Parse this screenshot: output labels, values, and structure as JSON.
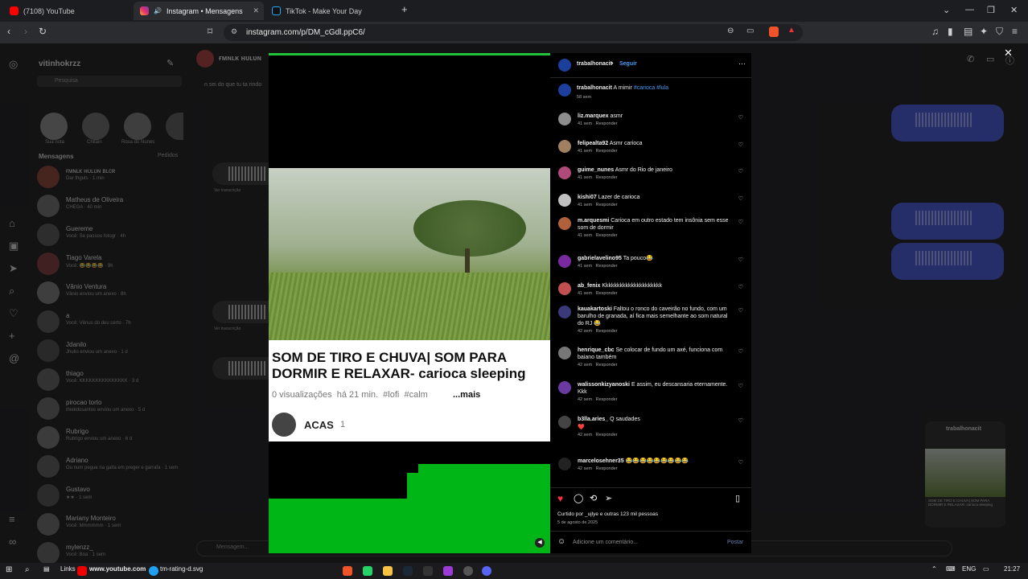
{
  "browser": {
    "tabs": [
      {
        "label": "(7108) YouTube"
      },
      {
        "label": "Instagram • Mensagens"
      },
      {
        "label": "TikTok - Make Your Day"
      }
    ],
    "url": "instagram.com/p/DM_cGdl.ppC6/"
  },
  "sidebar": {
    "username": "vitinhokrzz",
    "search_placeholder": "Pesquisa",
    "notes": [
      {
        "label": "Sua nota"
      },
      {
        "label": "Chitãin"
      },
      {
        "label": "Rosa do Nunes"
      }
    ],
    "section_title": "Mensagens",
    "section_link": "Pedidos",
    "threads": [
      {
        "name": "ғᴍɴʟᴋ ʜᴜʟᴜɴ ʙʟᴄʀ",
        "sub": "Dar thguts · 1 min"
      },
      {
        "name": "Matheus de Oliveira",
        "sub": "CHEGA · 40 min"
      },
      {
        "name": "Guereme",
        "sub": "Você: Se passou fotogr · 4h"
      },
      {
        "name": "Tiago Varela",
        "sub": "Você: 😂😂😂😂 · 9h"
      },
      {
        "name": "Vânio Ventura",
        "sub": "Vânio enviou um anexo · 8h"
      },
      {
        "name": "a",
        "sub": "Você: Vênus do deu certo · 7h"
      },
      {
        "name": "Jdanilo",
        "sub": "Jhulio enviou um anexo · 1 d"
      },
      {
        "name": "thiago",
        "sub": "Você: KKKKKKKKKKKKKKK · 3 d"
      },
      {
        "name": "pirocao torto",
        "sub": "thiekdosantos enviou um anexo · 5 d"
      },
      {
        "name": "Rubrigo",
        "sub": "Rubrigo enviou um anexo · 6 d"
      },
      {
        "name": "Adriano",
        "sub": "Ou num pegue na gaita em preger e garrafa · 1 sem"
      },
      {
        "name": "Gustavo",
        "sub": "★★ · 1 sem"
      },
      {
        "name": "Mariany Monteiro",
        "sub": "Você: Mmmmmm · 1 sem"
      },
      {
        "name": "mylenzz_",
        "sub": "Você: Boa · 1 sem"
      }
    ]
  },
  "chat": {
    "header_name": "ғᴍɴʟᴋ ʜᴜʟᴜɴ",
    "note": "n sei do que tu ta rindo",
    "voice_label": "Ver transcrição",
    "composer_placeholder": "Mensagem...",
    "shared_post_user": "trabalhonacit",
    "shared_post_caption": "SOM DE TIRO E CHUVA| SOM PARA DORMIR E RELAXAR- carioca sleeping"
  },
  "video": {
    "title": "SOM DE TIRO E CHUVA| SOM PARA DORMIR E RELAXAR- carioca sleeping",
    "meta": "0 visualizações  há 21 min.  #lofi  #calm",
    "more": "...mais",
    "channel": "ACAS",
    "subs": "1"
  },
  "post": {
    "author": "trabalhonacit",
    "follow": "Seguir",
    "caption_author": "trabalhonacit",
    "caption": "A mimir",
    "hashtags": "#carioca #lula",
    "caption_time": "58 sem",
    "reply_label": "Responder",
    "comments": [
      {
        "user": "liz.marquex",
        "text": "asmr",
        "time": "41 sem"
      },
      {
        "user": "felipealta92",
        "text": "Asmr carioca",
        "time": "41 sem"
      },
      {
        "user": "guime_nunes",
        "text": "Asmr do Rio de janeiro",
        "time": "41 sem"
      },
      {
        "user": "kishi07",
        "text": "Lazer de carioca",
        "time": "41 sem"
      },
      {
        "user": "m.arquesmi",
        "text": "Carioca em outro estado tem insônia sem esse som de dormir",
        "time": "41 sem"
      },
      {
        "user": "gabrielavelino95",
        "text": "Ta pouco😂",
        "time": "41 sem"
      },
      {
        "user": "ab_fenix",
        "text": "Kkkkkkkkkkkkkkkkkkkkk",
        "time": "41 sem"
      },
      {
        "user": "kauakartoski",
        "text": "Faltou o ronco do caveirão no fundo, com um barulho de granada, aí fica mais semelhante ao som natural do RJ 😂",
        "time": "42 sem"
      },
      {
        "user": "henrique_cbc",
        "text": "Se colocar de fundo um axé, funciona com baiano também",
        "time": "42 sem"
      },
      {
        "user": "walissonkizyanoski",
        "text": "E assim, eu descansaria eternamente. Kkk",
        "time": "42 sem"
      },
      {
        "user": "b3lla.aries_",
        "text": "Q saudades",
        "extra": "❤️",
        "time": "42 sem"
      },
      {
        "user": "marcelosehner35",
        "text": "😂😂😂😂😂😂😂😂😂",
        "time": "42 sem"
      }
    ],
    "likes": "Curtido por _ujlye e outras 123 mil pessoas",
    "date": "5 de agosto de 2025",
    "comment_placeholder": "Adicione um comentário...",
    "post_button": "Postar"
  },
  "taskbar": {
    "links": "Links",
    "youtube": "www.youtube.com",
    "svg_item": "tm-rating-d.svg",
    "lang": "ENG",
    "time": "21:27"
  },
  "colors": {
    "accent_blue": "#4a6cf7",
    "video_green": "#00b516",
    "like_red": "#ff3040"
  }
}
